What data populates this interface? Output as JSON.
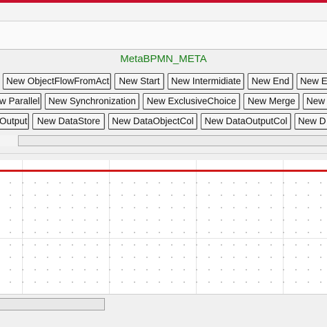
{
  "panel": {
    "title": "MetaBPMN_META"
  },
  "toolbar": {
    "row1": [
      "New ObjectFlowFromAct",
      "New Start",
      "New Intermidiate",
      "New End",
      "New E"
    ],
    "row2": [
      "w Parallel",
      "New Synchronization",
      "New ExclusiveChoice",
      "New Merge",
      "New"
    ],
    "row3": [
      "Output",
      "New DataStore",
      "New DataObjectCol",
      "New DataOutputCol",
      "New D"
    ]
  },
  "colors": {
    "accent_red": "#c8102e",
    "title_green": "#1a7f1a",
    "lane_red": "#d01a1a"
  }
}
